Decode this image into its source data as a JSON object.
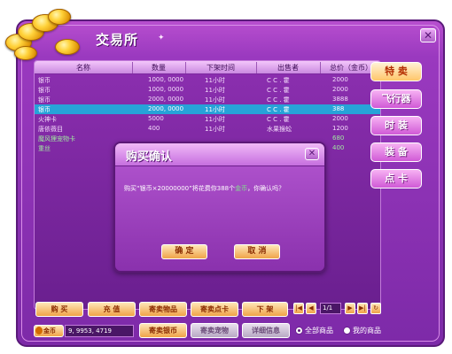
{
  "window": {
    "title": "交易所",
    "close_label": "✕"
  },
  "table": {
    "headers": [
      "名称",
      "数量",
      "下架时间",
      "出售者",
      "总价（金币）"
    ],
    "rows": [
      {
        "name": "银币",
        "qty": "1000, 0000",
        "time": "11小时",
        "seller": "C C . 霍",
        "price": "2000",
        "style": ""
      },
      {
        "name": "银币",
        "qty": "1000, 0000",
        "time": "11小时",
        "seller": "C C . 霍",
        "price": "2000",
        "style": ""
      },
      {
        "name": "银币",
        "qty": "2000, 0000",
        "time": "11小时",
        "seller": "C C . 霍",
        "price": "3888",
        "style": ""
      },
      {
        "name": "银币",
        "qty": "2000, 0000",
        "time": "11小时",
        "seller": "C C . 霍",
        "price": "388",
        "style": "selected"
      },
      {
        "name": "火神卡",
        "qty": "5000",
        "time": "11小时",
        "seller": "C C . 霍",
        "price": "2000",
        "style": ""
      },
      {
        "name": "唐依薇目",
        "qty": "400",
        "time": "11小时",
        "seller": "水果猴蚣",
        "price": "1200",
        "style": ""
      },
      {
        "name": "魔风狸宠物卡",
        "qty": "",
        "time": "",
        "seller": "",
        "price": "680",
        "style": "green"
      },
      {
        "name": "重丝",
        "qty": "",
        "time": "",
        "seller": "",
        "price": "400",
        "style": "green"
      }
    ]
  },
  "side_tabs": [
    "特 卖",
    "飞行器",
    "时 装",
    "装 备",
    "点 卡"
  ],
  "dialog": {
    "title": "购买确认",
    "message_prefix": "购买“银币×20000000”将花费你388个",
    "message_highlight": "金币",
    "message_suffix": "，你确认吗？",
    "ok_label": "确  定",
    "cancel_label": "取  消"
  },
  "bottom_buttons": {
    "buy": "购  买",
    "recharge": "充  值",
    "consign_item": "寄卖物品",
    "consign_card": "寄卖点卡",
    "delist": "下  架",
    "consign_silver": "寄卖银币",
    "consign_pet": "寄卖宠物",
    "details": "详细信息"
  },
  "pager": {
    "page": "1/1"
  },
  "gold": {
    "label": "金币",
    "value": "9, 9953, 4719"
  },
  "filters": {
    "all_items": "全部商品",
    "my_items": "我的商品",
    "selected": "all_items"
  }
}
